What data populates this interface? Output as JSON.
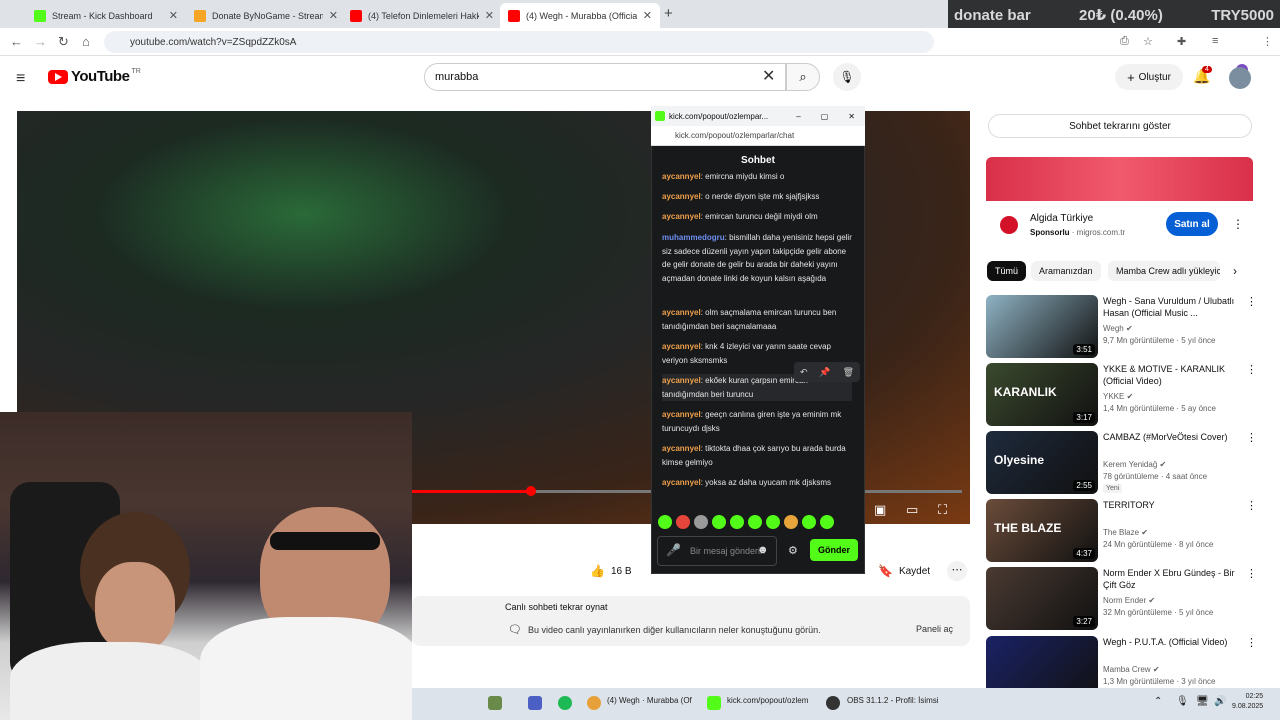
{
  "browser": {
    "tabs": [
      {
        "title": "Stream - Kick Dashboard",
        "color": "#53fc18"
      },
      {
        "title": "Donate ByNoGame - Streamer",
        "color": "#f5a623"
      },
      {
        "title": "(4) Telefon Dinlemeleri Hakkında",
        "color": "#ff0000"
      },
      {
        "title": "(4) Wegh - Murabba (Official V",
        "color": "#ff0000"
      }
    ],
    "url": "youtube.com/watch?v=ZSqpdZZk0sA"
  },
  "donate_bar": {
    "label": "donate bar",
    "amount": "20₺ (0.40%)",
    "goal": "TRY5000"
  },
  "youtube": {
    "logo": "YouTube",
    "region": "TR",
    "search_value": "murabba",
    "create_label": "Oluştur",
    "notif_count": "4",
    "likes": "16 B",
    "save_label": "Kaydet",
    "replay_title": "Canlı sohbeti tekrar oynat",
    "replay_desc": "Bu video canlı yayınlanırken diğer kullanıcıların neler konuştuğunu görün.",
    "replay_btn": "Paneli aç",
    "chat_replay_label": "Sohbet tekrarını göster"
  },
  "ad": {
    "title": "Algida Türkiye",
    "sponsor": "Sponsorlu",
    "domain": "· migros.com.tr",
    "buy_label": "Satın al"
  },
  "chips": [
    "Tümü",
    "Aramanızdan",
    "Mamba Crew adlı yükleyiciden"
  ],
  "recommendations": [
    {
      "title": "Wegh - Sana Vuruldum / Ulubatlı Hasan (Official Music ...",
      "channel": "Wegh",
      "meta": "9,7 Mn görüntüleme · 5 yıl önce",
      "duration": "3:51",
      "thumb": "#8fb3c4"
    },
    {
      "title": "YKKE & MOTIVE - KARANLIK (Official Video)",
      "channel": "YKKE",
      "meta": "1,4 Mn görüntüleme · 5 ay önce",
      "duration": "3:17",
      "thumb": "#3b4a2e",
      "thumb_text": "KARANLIK"
    },
    {
      "title": "CAMBAZ (#MorVeÖtesi Cover)",
      "channel": "Kerem Yenidağ",
      "meta": "78 görüntüleme · 4 saat önce",
      "badge": "Yeni",
      "duration": "2:55",
      "thumb": "#1e2a3c",
      "thumb_text": "Olyesine"
    },
    {
      "title": "TERRITORY",
      "channel": "The Blaze",
      "meta": "24 Mn görüntüleme · 8 yıl önce",
      "duration": "4:37",
      "thumb": "#6b4c3a",
      "thumb_text": "THE BLAZE"
    },
    {
      "title": "Norm Ender X Ebru Gündeş - Bir Çift Göz",
      "channel": "Norm Ender",
      "meta": "32 Mn görüntüleme · 5 yıl önce",
      "duration": "3:27",
      "thumb": "#4a3a32"
    },
    {
      "title": "Wegh - P.U.T.A. (Official Video)",
      "channel": "Mamba Crew",
      "meta": "1,3 Mn görüntüleme · 3 yıl önce",
      "duration": "",
      "thumb": "#1a2266"
    }
  ],
  "popup": {
    "title": "kick.com/popout/ozlempar...",
    "url": "kick.com/popout/ozlemparlar/chat",
    "header": "Sohbet",
    "messages": [
      {
        "user": "aycannyel",
        "color": "#f0a04b",
        "text": "emircna miydu kimsi o"
      },
      {
        "user": "aycannyel",
        "color": "#f0a04b",
        "text": "o nerde diyom işte mk sjajfjsjkss"
      },
      {
        "user": "aycannyel",
        "color": "#f0a04b",
        "text": "emircan turuncu değil miydi olm"
      },
      {
        "user": "muhammedogru",
        "color": "#6c8ff0",
        "text": "bismillah daha yenisiniz hepsi gelir siz sadece düzenli yayın yapın takipçide gelir abone de gelir donate de gelir bu arada bir daheki yayını açmadan donate linki de koyun kalsın aşağıda"
      },
      {
        "user": "aycannyel",
        "color": "#f0a04b",
        "text": "olm saçmalama emircan turuncu ben tanıdığımdan beri saçmalamaaa"
      },
      {
        "user": "aycannyel",
        "color": "#f0a04b",
        "text": "knk 4 izleyici var yarım saate cevap veriyon sksmsmks"
      },
      {
        "user": "aycannyel",
        "color": "#f0a04b",
        "text": "ekőek kuran çarpsın emircan tanıdığımdan beri turuncu"
      },
      {
        "user": "aycannyel",
        "color": "#f0a04b",
        "text": "geeçn canlına giren işte ya eminim mk turuncuydı djsks"
      },
      {
        "user": "aycannyel",
        "color": "#f0a04b",
        "text": "tiktokta dhaa çok sarıyo bu arada burda kimse gelmiyo"
      },
      {
        "user": "aycannyel",
        "color": "#f0a04b",
        "text": "yoksa az daha uyucam mk djsksms"
      }
    ],
    "input_placeholder": "Bir mesaj gönderin",
    "send_label": "Gönder"
  },
  "taskbar": {
    "items": [
      "(4) Wegh · Murabba (Of",
      "kick.com/popout/ozlem",
      "OBS 31.1.2 - Profil: İsimsi"
    ],
    "time": "02:25",
    "date": "9.08.2025"
  }
}
